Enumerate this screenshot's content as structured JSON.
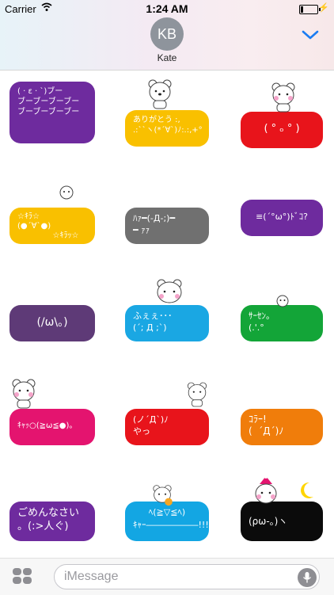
{
  "status": {
    "carrier": "Carrier",
    "time": "1:24 AM"
  },
  "header": {
    "avatar_initials": "KB",
    "contact_name": "Kate"
  },
  "stickers": [
    {
      "color": "#6e2b9e",
      "text": "( · ε · `)ブー\nブーブーブーブー\nブーブーブーブー"
    },
    {
      "color": "#f9c000",
      "text": "ありがとう :,\n.:``ヽ(*´∀`)ﾉ:.:,+°"
    },
    {
      "color": "#e8141b",
      "text": "( ° ₒ ° )"
    },
    {
      "color": "#f9c000",
      "text": "☆ｷﾗ☆\n(●´∀`●)\n              ☆ｷﾗｯ☆"
    },
    {
      "color": "#707070",
      "text": "ﾊｧ━(-Д-;)━\n━ ｧｧ"
    },
    {
      "color": "#6e2b9e",
      "text": "≡(´°ω°)ﾄﾞｺ?"
    },
    {
      "color": "#5e3a77",
      "text": "(/ω\\。)"
    },
    {
      "color": "#1aa7e3",
      "text": "ふぇぇ･･･\n(´; Д ;`)"
    },
    {
      "color": "#13a538",
      "text": "ｻｰｾﾝ。\n(.'.°"
    },
    {
      "color": "#e4146f",
      "text": "ｷｬｯ○(≧ω≦●)。"
    },
    {
      "color": "#e8141b",
      "text": "(ノ´Д`)ﾉ\nやっ"
    },
    {
      "color": "#f07d0b",
      "text": "ｺﾗｰ!\n(  ´Д´)ﾉ"
    },
    {
      "color": "#6e2b9e",
      "text": "ごめんなさい\n。(:>人ぐ)"
    },
    {
      "color": "#13a6e3",
      "text": "ﾍ(≧▽≦ﾍ)\nｷｬｰ――――――!!!!"
    },
    {
      "color": "#0b0b0b",
      "text": "(ρω-。)ヽ"
    }
  ],
  "compose": {
    "placeholder": "iMessage"
  },
  "icons": {
    "wifi": "wifi-icon",
    "battery": "battery-icon",
    "collapse": "chevron-down-icon",
    "apps": "app-drawer-icon",
    "mic": "microphone-icon",
    "bear": "bear-mascot-icon"
  },
  "colors": {
    "accent": "#1b7cf2",
    "avatar": "#8e949c"
  }
}
